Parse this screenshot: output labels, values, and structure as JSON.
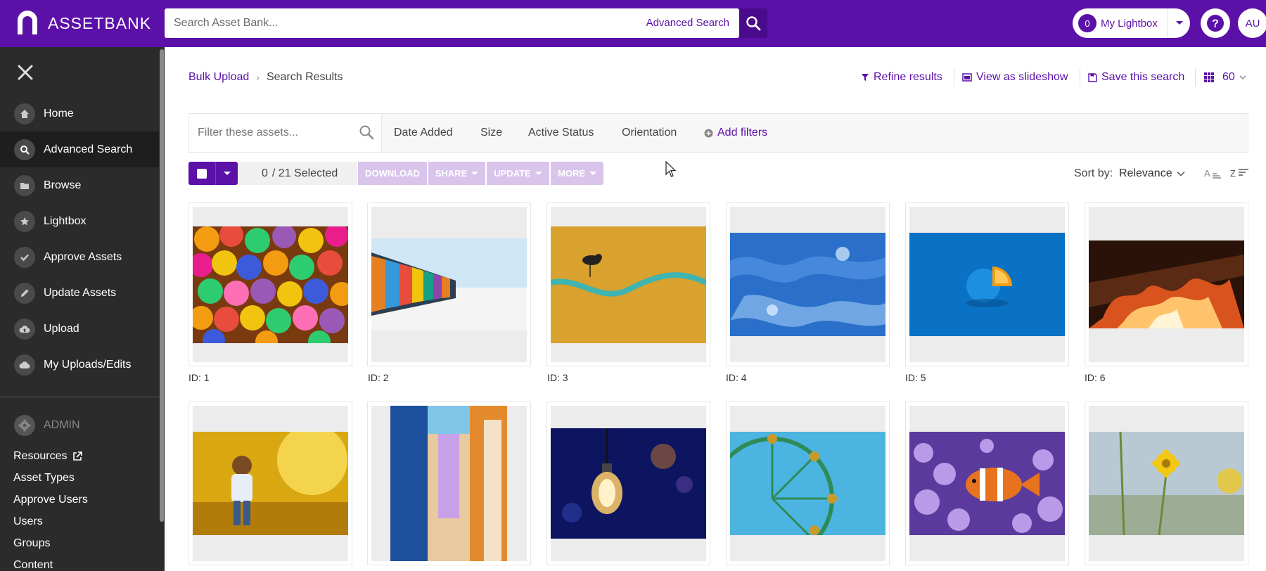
{
  "app": {
    "brand": "ASSETBANK",
    "accent": "#5b10a8"
  },
  "header": {
    "search_placeholder": "Search Asset Bank...",
    "advanced_search_link": "Advanced Search",
    "lightbox_count": "0",
    "lightbox_label": "My Lightbox",
    "avatar_initials": "AU"
  },
  "sidebar": {
    "items": [
      {
        "label": "Home",
        "icon": "home-icon"
      },
      {
        "label": "Advanced Search",
        "icon": "search-icon",
        "active": true
      },
      {
        "label": "Browse",
        "icon": "folder-icon"
      },
      {
        "label": "Lightbox",
        "icon": "star-icon"
      },
      {
        "label": "Approve Assets",
        "icon": "check-icon"
      },
      {
        "label": "Update Assets",
        "icon": "pencil-icon"
      },
      {
        "label": "Upload",
        "icon": "cloud-upload-icon"
      },
      {
        "label": "My Uploads/Edits",
        "icon": "cloud-icon"
      }
    ],
    "admin_label": "ADMIN",
    "admin_links": [
      "Resources",
      "Asset Types",
      "Approve Users",
      "Users",
      "Groups",
      "Content"
    ]
  },
  "breadcrumb": {
    "parent": "Bulk Upload",
    "current": "Search Results"
  },
  "actions": {
    "refine": "Refine results",
    "slideshow": "View as slideshow",
    "save_search": "Save this search",
    "page_size": "60"
  },
  "filters": {
    "placeholder": "Filter these assets...",
    "tabs": [
      "Date Added",
      "Size",
      "Active Status",
      "Orientation"
    ],
    "add": "Add filters"
  },
  "selection": {
    "selected": "0",
    "total_text": "/ 21 Selected",
    "buttons": [
      "DOWNLOAD",
      "SHARE",
      "UPDATE",
      "MORE"
    ]
  },
  "sort": {
    "label": "Sort by:",
    "value": "Relevance"
  },
  "assets": [
    {
      "id_label": "ID: 1",
      "subject": "colorful balls"
    },
    {
      "id_label": "ID: 2",
      "subject": "beach huts"
    },
    {
      "id_label": "ID: 3",
      "subject": "bird on wave"
    },
    {
      "id_label": "ID: 4",
      "subject": "blue water"
    },
    {
      "id_label": "ID: 5",
      "subject": "orange on blue"
    },
    {
      "id_label": "ID: 6",
      "subject": "fire"
    },
    {
      "id_label": "",
      "subject": "child in sunlight"
    },
    {
      "id_label": "",
      "subject": "colorful alley"
    },
    {
      "id_label": "",
      "subject": "light bulb"
    },
    {
      "id_label": "",
      "subject": "ferris wheel"
    },
    {
      "id_label": "",
      "subject": "clownfish"
    },
    {
      "id_label": "",
      "subject": "yellow flower"
    }
  ]
}
